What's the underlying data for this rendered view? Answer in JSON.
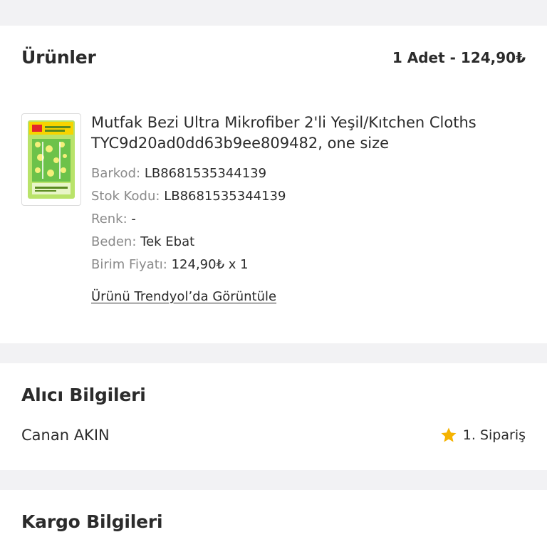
{
  "products": {
    "title": "Ürünler",
    "summary": "1 Adet - 124,90₺",
    "item": {
      "name": "Mutfak Bezi Ultra Mikrofiber 2'li Yeşil/Kıtchen Cloths TYC9d20ad0dd63b9ee809482, one size",
      "barcode_label": "Barkod:",
      "barcode": "LB8681535344139",
      "stock_label": "Stok Kodu:",
      "stock": "LB8681535344139",
      "color_label": "Renk:",
      "color": "-",
      "size_label": "Beden:",
      "size": "Tek Ebat",
      "unit_price_label": "Birim Fiyatı:",
      "unit_price": "124,90₺ x 1",
      "view_link": "Ürünü Trendyol’da Görüntüle",
      "thumbnail_icon": "product-thumbnail"
    }
  },
  "buyer": {
    "title": "Alıcı Bilgileri",
    "name": "Canan AKIN",
    "order_count": "1. Sipariş",
    "star_icon": "star-icon",
    "star_color": "#f5b301"
  },
  "cargo": {
    "title": "Kargo Bilgileri"
  }
}
